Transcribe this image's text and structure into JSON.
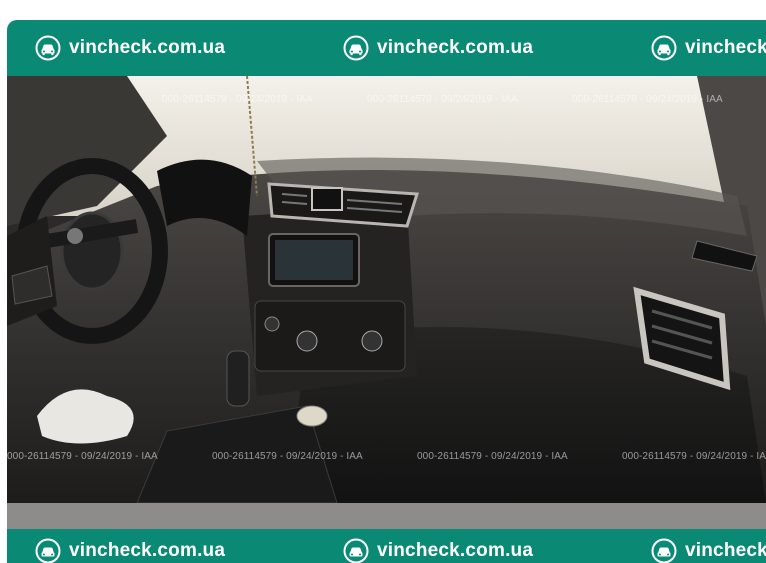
{
  "brand": {
    "site": "vincheck.com.ua",
    "icon": "car-front-icon",
    "color": "#0a8a74"
  },
  "watermark": {
    "text": "000-26114579 - 09/24/2019 - IAA"
  },
  "photo": {
    "subject": ""
  }
}
